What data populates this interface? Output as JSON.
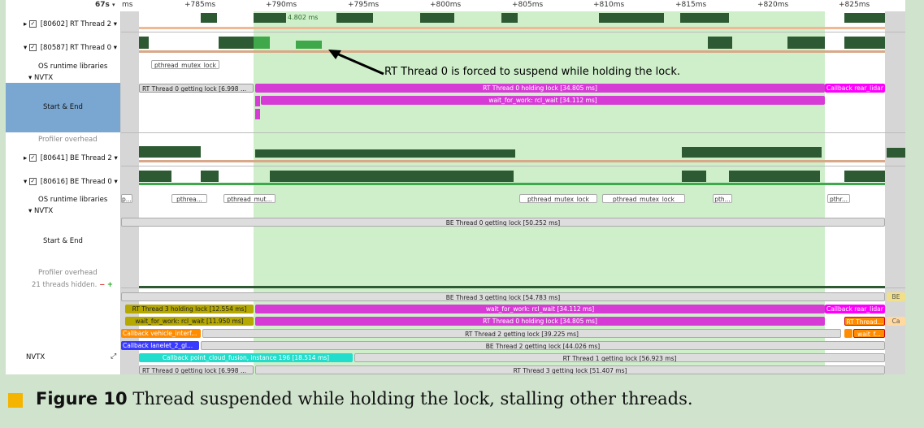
{
  "ruler": {
    "zoom": "67s",
    "ticks": [
      "ms",
      "+785ms",
      "+790ms",
      "+795ms",
      "+800ms",
      "+805ms",
      "+810ms",
      "+815ms",
      "+820ms",
      "+825ms"
    ]
  },
  "rows": {
    "rt2": "[80602] RT Thread 2",
    "rt0": "[80587] RT Thread 0",
    "os1": "OS runtime libraries",
    "nvtx1": "NVTX",
    "startend1": "Start & End",
    "overhead1": "Profiler overhead",
    "be2": "[80641] BE Thread 2",
    "be0": "[80616] BE Thread 0",
    "os2": "OS runtime libraries",
    "nvtx2": "NVTX",
    "startend2": "Start & End",
    "overhead2": "Profiler overhead",
    "hidden": "21 threads hidden.",
    "nvtx3": "NVTX"
  },
  "labels": {
    "rt2_inline": "4.802 ms",
    "mutex_rt0": "pthread_mutex_lock",
    "rt0_getting": "RT Thread 0 getting lock [6.998 ...",
    "rt0_holding": "RT Thread 0 holding lock [34.805 ms]",
    "cb_rear": "Callback rear_lidar",
    "rt0_wait": "wait_for_work: rcl_wait [34.112 ms]",
    "os2_p": "p...",
    "os2_pthrea": "pthrea...",
    "os2_mut": "pthread_mut...",
    "os2_m1": "pthread_mutex_lock",
    "os2_m2": "pthread_mutex_lock",
    "os2_pth": "pth...",
    "os2_pthr": "pthr...",
    "be0_getting": "BE Thread 0 getting lock [50.252 ms]",
    "be3_getting": "BE Thread 3 getting lock [54.783 ms]",
    "be_short": "BE",
    "rt3_holding": "RT Thread 3 holding lock [12.554 ms]",
    "wait1": "wait_for_work: rcl_wait [34.112 ms]",
    "cb_rear2": "Callback rear_lidar",
    "wait2": "wait_for_work: rcl_wait [11.950 ms]",
    "rt0_holding2": "RT Thread 0 holding lock [34.805 ms]",
    "rt_short": "RT Thread...",
    "ca": "Ca",
    "cb_vehicle": "Callback vehicle_interf...",
    "rt2_getting": "RT Thread 2 getting lock [39.225 ms]",
    "wait_f": "wait_f...",
    "cb_lanelet": "Callback lanelet_2_gl...",
    "be2_getting": "BE Thread 2 getting lock [44.026 ms]",
    "cb_point": "Callback point_cloud_fusion, instance 196 [18.514 ms]",
    "rt1_getting": "RT Thread 1 getting lock [56.923 ms]",
    "rt0_getting2": "RT Thread 0 getting lock [6.998 ...",
    "rt3_getting": "RT Thread 3 getting lock [51.407 ms]"
  },
  "annotation": "RT Thread 0 is forced to suspend while holding the lock.",
  "caption": {
    "label": "Figure 10",
    "text": "Thread suspended while holding the lock, stalling other threads."
  },
  "colors": {
    "highlight": "#b9e8b3",
    "holding": "#d63bd6",
    "getting": "#d8d8d8",
    "callback_magenta": "#ff00ff",
    "olive": "#b5a800",
    "orange": "#ff8c00",
    "blue": "#3a3aff",
    "cyan": "#22ddcc",
    "activity": "#2d5a32",
    "caption_bg": "#cfe3cd",
    "caption_square": "#f5b400"
  }
}
